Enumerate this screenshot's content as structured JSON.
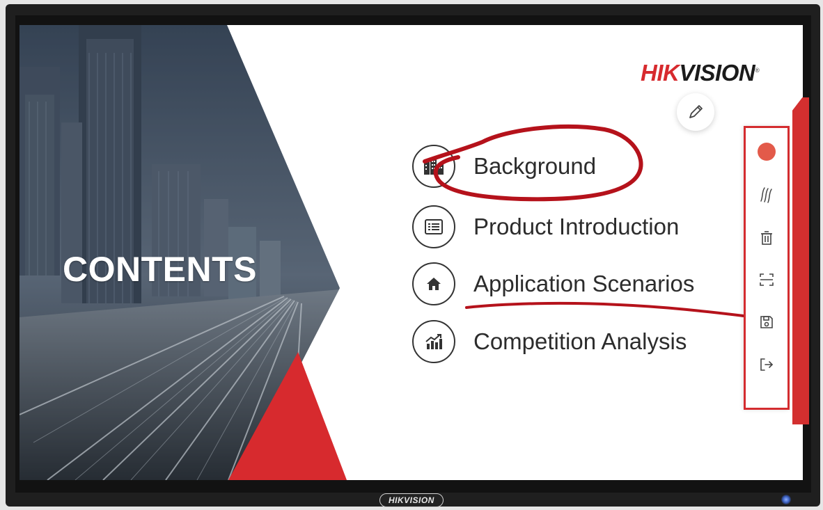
{
  "brand": {
    "logo_red": "HIK",
    "logo_dark": "VISION",
    "logo_mark": "®",
    "bezel_label": "HIKVISION"
  },
  "slide": {
    "title": "CONTENTS",
    "items": [
      {
        "label": "Background",
        "icon": "buildings-icon"
      },
      {
        "label": "Product Introduction",
        "icon": "document-list-icon"
      },
      {
        "label": "Application Scenarios",
        "icon": "home-icon"
      },
      {
        "label": "Competition Analysis",
        "icon": "growth-chart-icon"
      }
    ]
  },
  "toolbar": {
    "tools": [
      {
        "name": "red-pen-color",
        "icon": "color-dot-icon"
      },
      {
        "name": "stroke-style",
        "icon": "strokes-icon"
      },
      {
        "name": "clear",
        "icon": "trash-icon"
      },
      {
        "name": "screenshot",
        "icon": "capture-icon"
      },
      {
        "name": "save",
        "icon": "save-icon"
      },
      {
        "name": "exit",
        "icon": "exit-icon"
      }
    ]
  },
  "colors": {
    "accent_red": "#d72a2e",
    "ink_red": "#b5121b",
    "text": "#2c2c2c"
  }
}
